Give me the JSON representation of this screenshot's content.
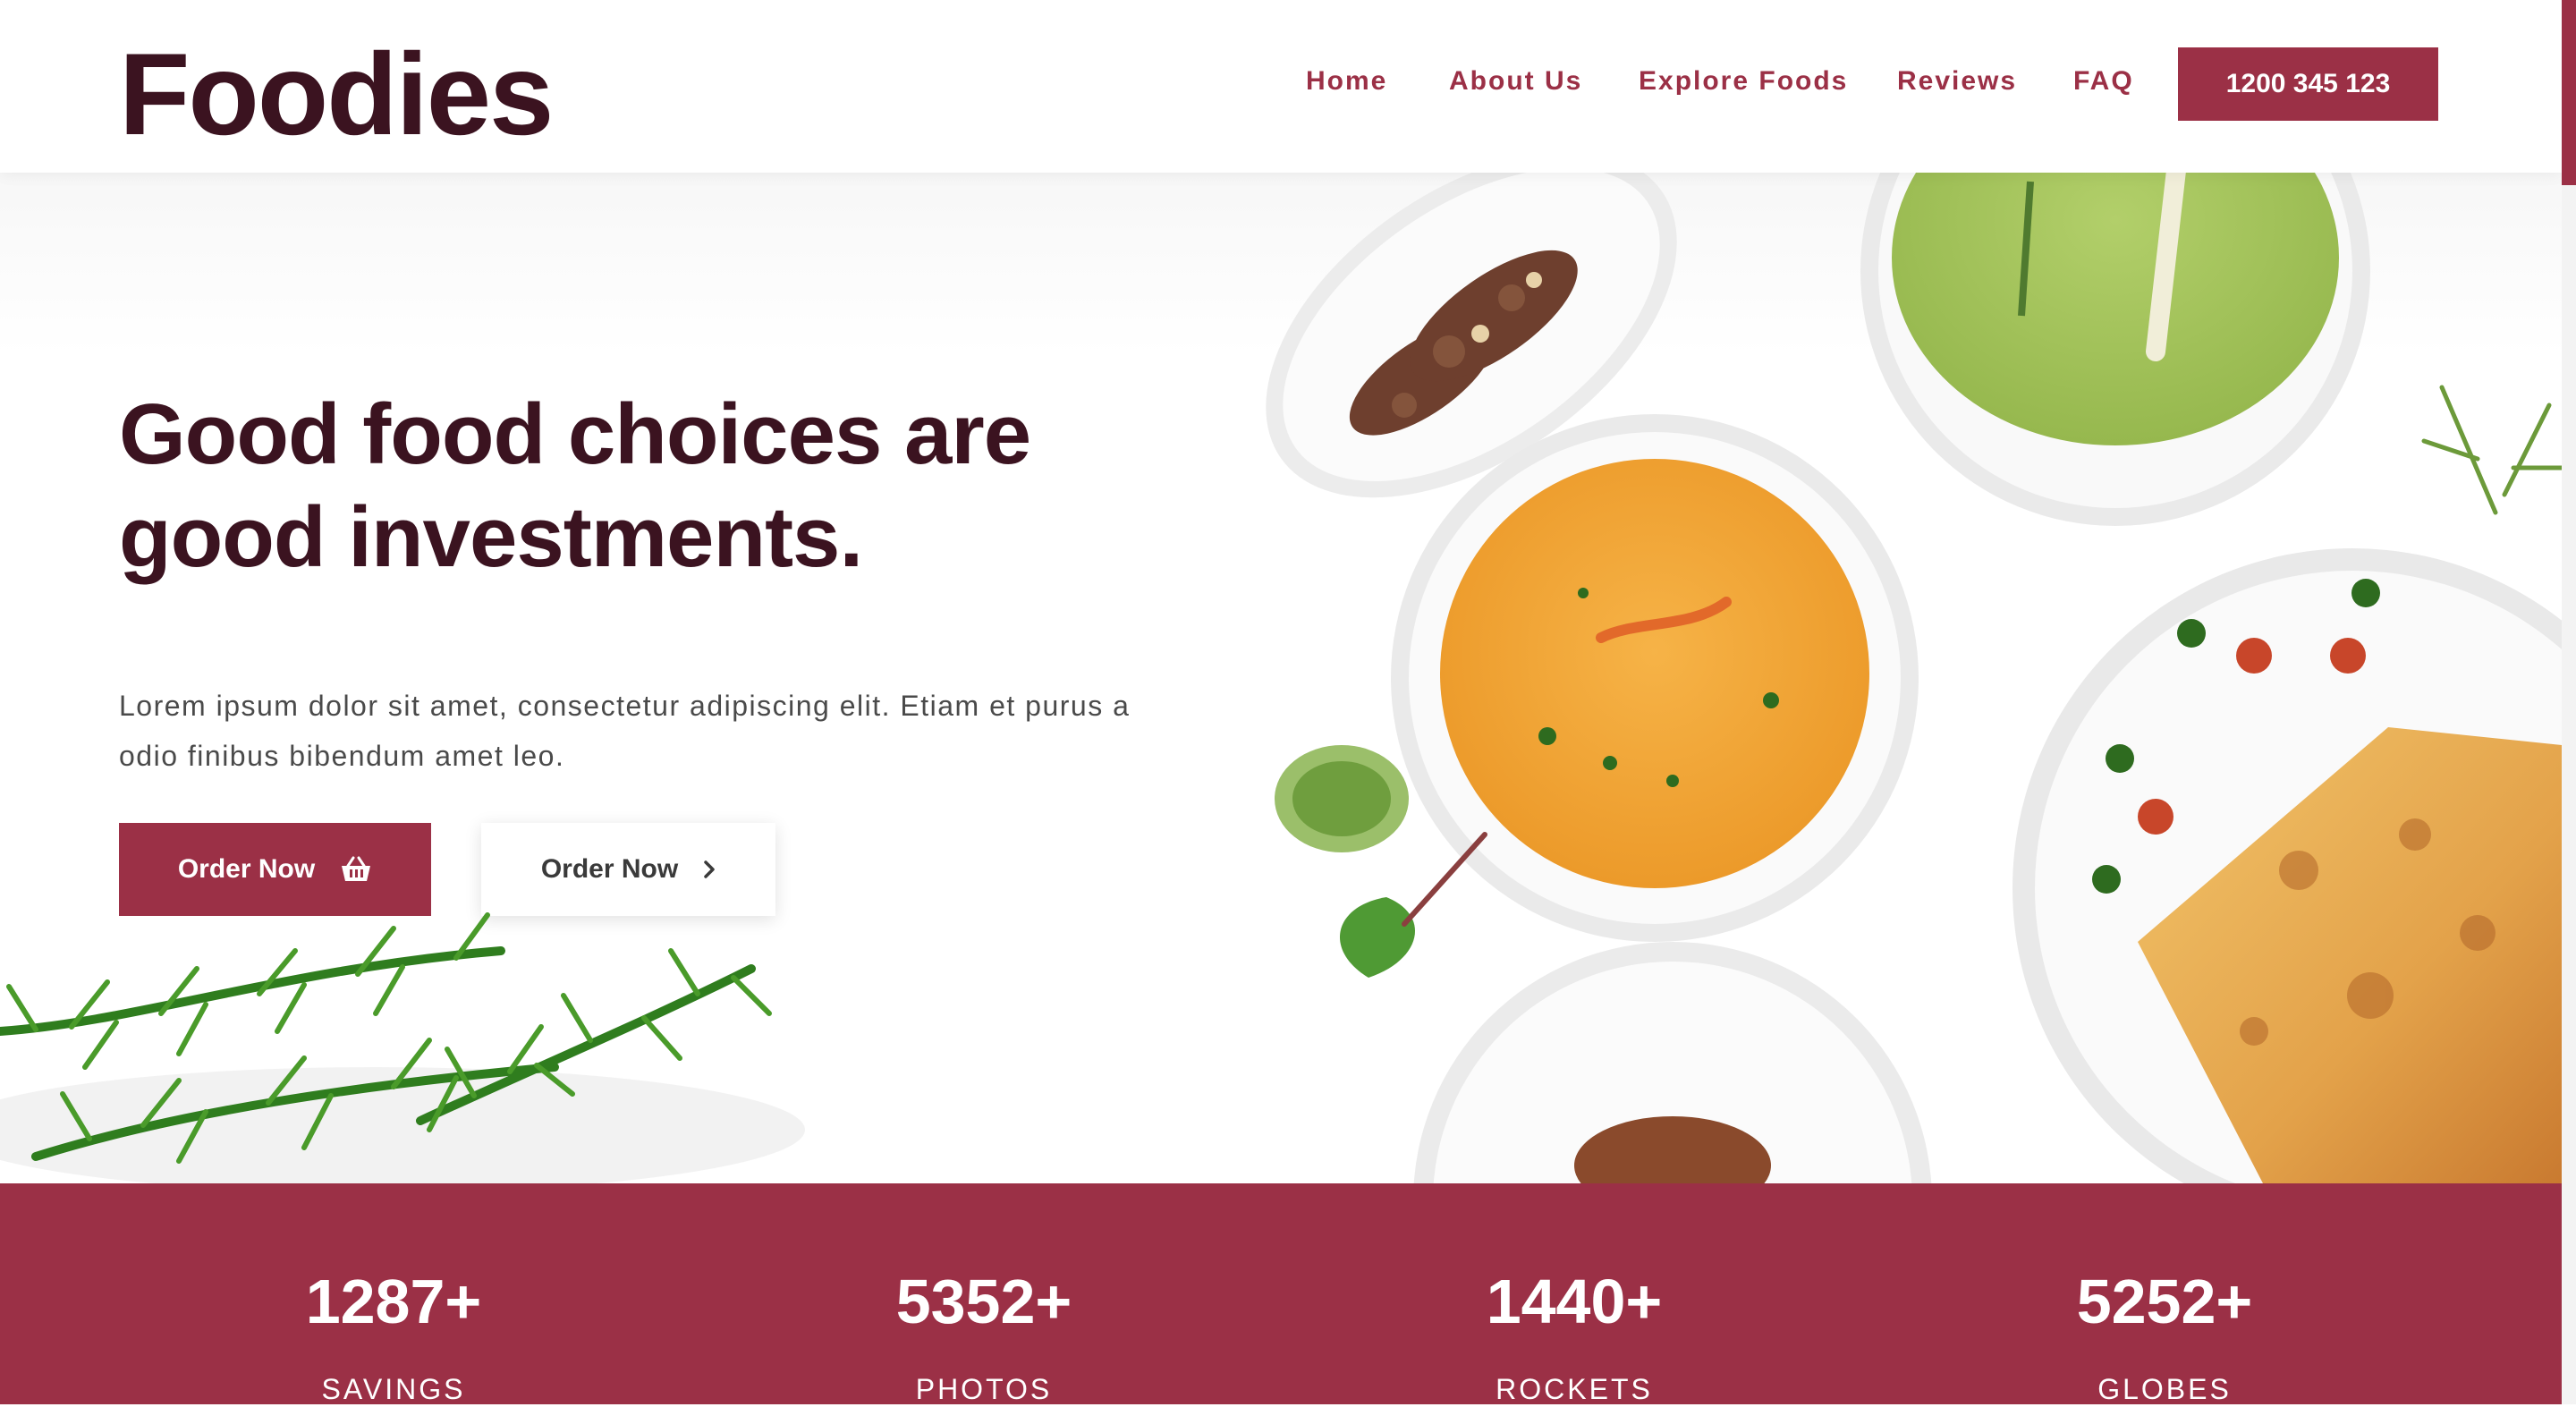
{
  "brand": {
    "logo": "Foodies"
  },
  "nav": {
    "links": [
      "Home",
      "About Us",
      "Explore Foods",
      "Reviews",
      "FAQ"
    ],
    "phone": "1200 345 123"
  },
  "hero": {
    "headline": "Good food choices are good investments.",
    "intro": "Lorem ipsum dolor sit amet, consectetur adipiscing elit. Etiam et purus a odio finibus bibendum amet leo.",
    "primary_button": "Order Now",
    "secondary_button": "Order Now"
  },
  "stats": [
    {
      "value": "1287+",
      "label": "SAVINGS"
    },
    {
      "value": "5352+",
      "label": "PHOTOS"
    },
    {
      "value": "1440+",
      "label": "ROCKETS"
    },
    {
      "value": "5252+",
      "label": "GLOBES"
    }
  ],
  "colors": {
    "accent": "#9b3046",
    "heading": "#3b1320",
    "body_text": "#4a4a4a"
  },
  "icons": [
    "basket-icon",
    "chevron-right-icon"
  ]
}
